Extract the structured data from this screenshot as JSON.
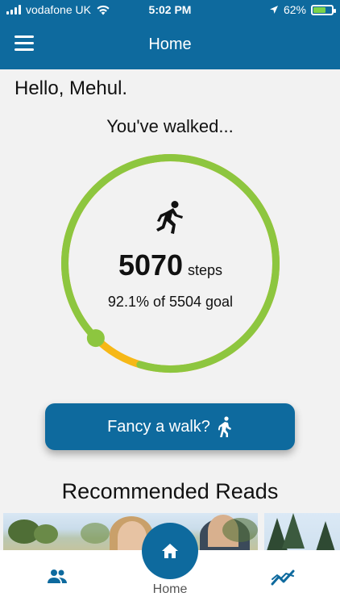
{
  "status": {
    "carrier": "vodafone UK",
    "time": "5:02 PM",
    "battery": "62%",
    "battery_level": 0.62
  },
  "header": {
    "title": "Home",
    "menu_icon": "hamburger-menu-icon"
  },
  "greeting": "Hello, Mehul.",
  "walked_label": "You've walked...",
  "steps": {
    "count": "5070",
    "unit": "steps",
    "progress_text": "92.1% of 5504 goal",
    "progress_fraction": 0.921,
    "colors": {
      "progress": "#8dc63f",
      "remaining": "#f6b817"
    }
  },
  "walk_button": {
    "label": "Fancy a walk?",
    "icon": "walking-person-icon"
  },
  "reads": {
    "title": "Recommended Reads"
  },
  "bottom_nav": {
    "left_icon": "people-icon",
    "home_label": "Home",
    "home_icon": "home-icon",
    "right_icon": "trend-chart-icon",
    "accent": "#0e6a9e"
  }
}
